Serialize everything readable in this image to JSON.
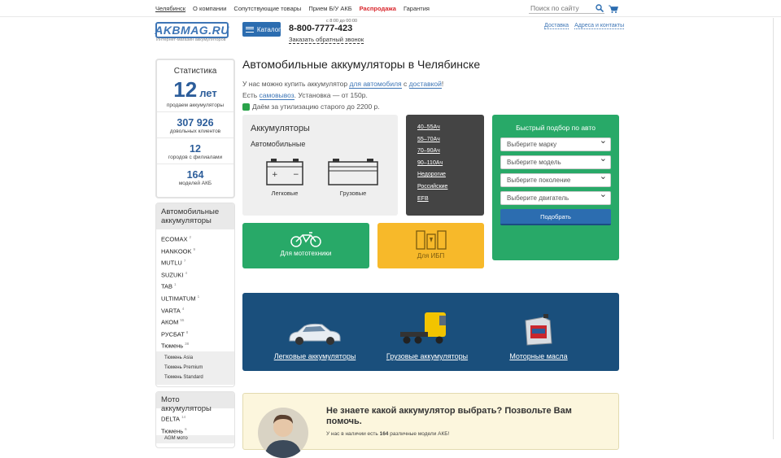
{
  "topnav": {
    "city": "Челябинск",
    "items": [
      "О компании",
      "Сопутствующие товары",
      "Прием Б/У АКБ"
    ],
    "sale": "Распродажа",
    "warranty": "Гарантия",
    "search_placeholder": "Поиск по сайту"
  },
  "header": {
    "logo": "AKBMAG.RU",
    "logo_tagline": "Интернет-магазин аккумуляторов",
    "catalog": "Каталог",
    "hours": "с 8:00 до 00:00",
    "phone": "8-800-7777-423",
    "callback": "Заказать обратный звонок",
    "links": [
      "Доставка",
      "Адреса и контакты"
    ]
  },
  "stats": {
    "title": "Статистика",
    "years_num": "12",
    "years_unit": "лет",
    "years_label": "продаем аккумуляторы",
    "clients_num": "307 926",
    "clients_label": "довольных клиентов",
    "cities_num": "12",
    "cities_label": "городов с филиалами",
    "models_num": "164",
    "models_label": "моделей АКБ"
  },
  "auto_brands": {
    "title": "Автомобильные аккумуляторы",
    "items": [
      {
        "name": "ECOMAX",
        "count": "2"
      },
      {
        "name": "HANKOOK",
        "count": "9"
      },
      {
        "name": "MUTLU",
        "count": "7"
      },
      {
        "name": "SUZUKI",
        "count": "4"
      },
      {
        "name": "TAB",
        "count": "1"
      },
      {
        "name": "ULTIMATUM",
        "count": "1"
      },
      {
        "name": "VARTA",
        "count": "4"
      },
      {
        "name": "АКОМ",
        "count": "55"
      },
      {
        "name": "РУСБАТ",
        "count": "8"
      },
      {
        "name": "Тюмень",
        "count": "38"
      }
    ],
    "sub_items": [
      "Тюмень Asia",
      "Тюмень Premium",
      "Тюмень Standard"
    ]
  },
  "moto_brands": {
    "title": "Мото аккумуляторы",
    "items": [
      {
        "name": "DELTA",
        "count": "14"
      },
      {
        "name": "Тюмень",
        "count": "6"
      }
    ],
    "sub_items": [
      "AGM мото"
    ]
  },
  "main": {
    "title": "Автомобильные аккумуляторы в Челябинске",
    "intro_1": "У нас можно купить аккумулятор ",
    "intro_link_1": "для автомобиля",
    "intro_mid": " с ",
    "intro_link_2": "доставкой",
    "intro_end": "!",
    "intro_2a": "Есть ",
    "intro_link_3": "самовывоз",
    "intro_2b": ". Установка — от 150р.",
    "intro_3": "Даём за утилизацию старого до 2200 р."
  },
  "batteries_card": {
    "title": "Аккумуляторы",
    "subtitle": "Автомобильные",
    "light": "Легковые",
    "heavy": "Грузовые"
  },
  "capacity_card": {
    "links": [
      "40–55Ач",
      "55–70Ач",
      "70–90Ач",
      "90–110Ач",
      "Недорогие",
      "Российские",
      "EFB"
    ]
  },
  "quick_pick": {
    "title": "Быстрый подбор по авто",
    "selects": [
      "Выберите марку",
      "Выберите модель",
      "Выберите поколение",
      "Выберите двигатель"
    ],
    "button": "Подобрать"
  },
  "moto_card": {
    "label": "Для мототехники"
  },
  "ups_card": {
    "label": "Для ИБП"
  },
  "banner": {
    "items": [
      "Легковые аккумуляторы",
      "Грузовые аккумуляторы",
      "Моторные масла"
    ]
  },
  "helper": {
    "title": "Не знаете какой аккумулятор выбрать? Позвольте Вам помочь.",
    "sub_a": "У нас в наличии есть ",
    "sub_num": "164",
    "sub_b": " различные модели АКБ!"
  },
  "colors": {
    "accent_blue": "#2c6db0",
    "green": "#28a968",
    "yellow": "#f7b92a",
    "dark_card": "#444444",
    "banner": "#1a4f7c",
    "sale_red": "#d9262c"
  }
}
